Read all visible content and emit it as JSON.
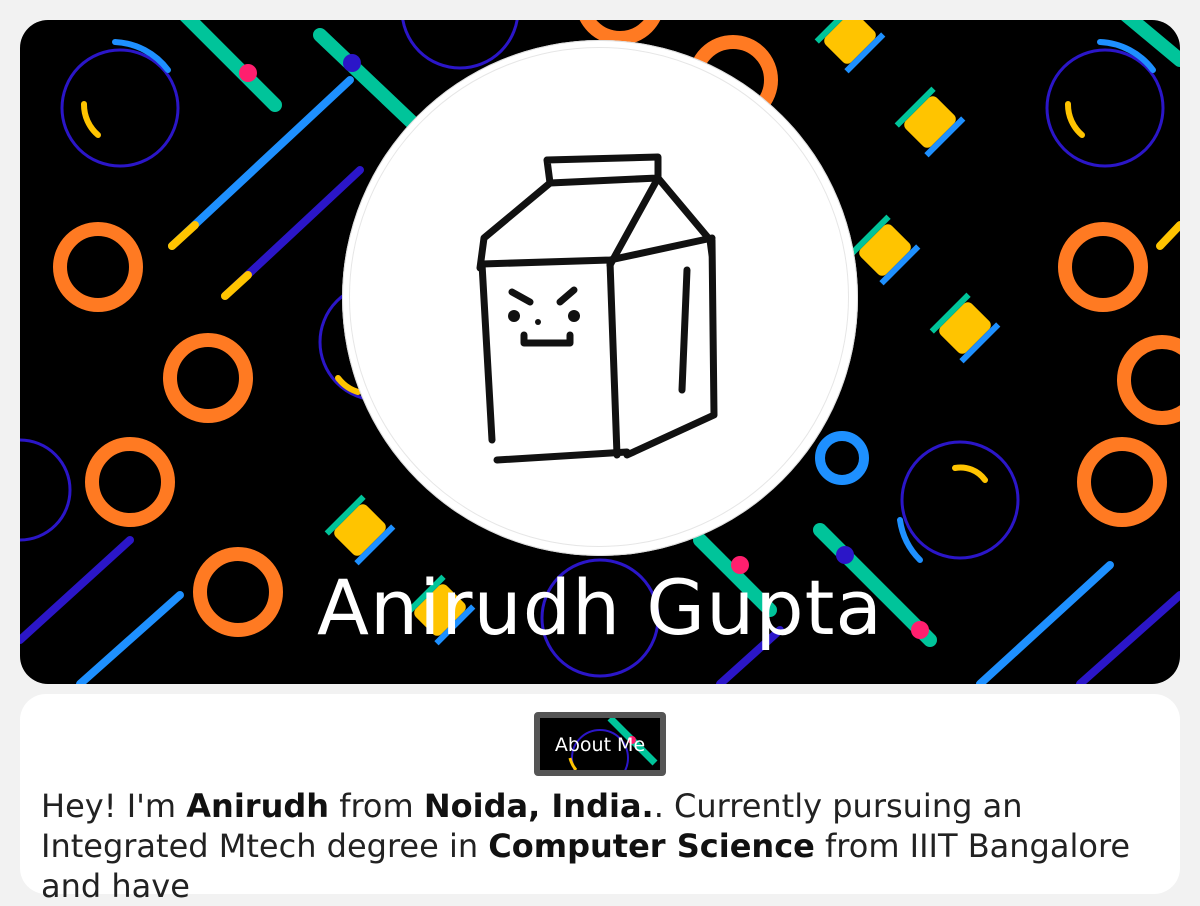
{
  "profile": {
    "name": "Anirudh Gupta"
  },
  "about": {
    "button_label": "About Me",
    "intro": {
      "greeting": "Hey! I'm ",
      "first_name": "Anirudh",
      "from": " from ",
      "location": "Noida, India.",
      "sentence2": ". Currently pursuing an Integrated Mtech degree in ",
      "field": "Computer Science",
      "rest": " from IIIT Bangalore and have"
    }
  },
  "colors": {
    "background": "#f2f2f2",
    "hero_bg": "#000000",
    "orange": "#ff7a22",
    "green": "#00c49a",
    "yellow": "#ffc400",
    "blue": "#1e90ff",
    "indigo": "#2b16c8",
    "pink": "#ff1f6e"
  }
}
